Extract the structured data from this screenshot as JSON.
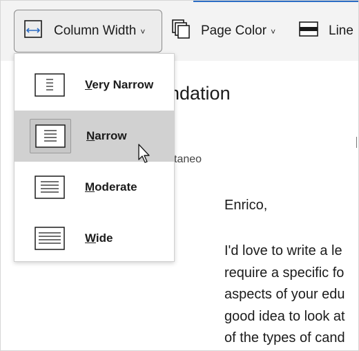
{
  "ribbon": {
    "column_width": {
      "label": "Column Width",
      "chevron": "˅",
      "icon": "column-width-icon"
    },
    "page_color": {
      "label": "Page Color",
      "chevron": "˅",
      "icon": "page-color-icon"
    },
    "line": {
      "label": "Line",
      "icon": "line-icon"
    },
    "accent_color": "#2b6cc4"
  },
  "menu": {
    "items": [
      {
        "accel": "V",
        "rest": "ery Narrow",
        "selected": false
      },
      {
        "accel": "N",
        "rest": "arrow",
        "selected": true
      },
      {
        "accel": "M",
        "rest": "oderate",
        "selected": false
      },
      {
        "accel": "W",
        "rest": "ide",
        "selected": false
      }
    ],
    "selected_color": "#d1d1d1"
  },
  "document": {
    "title_partial": "ndation",
    "subtitle_partial": "taneo",
    "greeting": "Enrico,",
    "paragraph_lines": [
      "I'd love to write a le",
      "require a specific fo",
      "aspects of your edu",
      "good idea to look at",
      "of the types of cand"
    ]
  }
}
